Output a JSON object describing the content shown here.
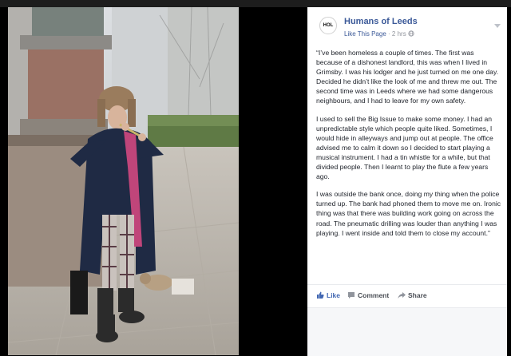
{
  "post": {
    "page_name": "Humans of Leeds",
    "logo_text": "HOL",
    "like_page": "Like This Page",
    "separator": "·",
    "time": "2 hrs",
    "paragraphs": [
      "“I’ve been homeless a couple of times. The first was because of a dishonest landlord, this was when I lived in Grimsby. I was his lodger and he just turned on me one day. Decided he didn’t like the look of me and threw me out. The second time was in Leeds where we had some dangerous neighbours, and I had to leave for my own safety.",
      "I used to sell the Big Issue to make some money. I had an unpredictable style which people quite liked. Sometimes, I would hide in alleyways and jump out at people. The office advised me to calm it down so I decided to start playing a musical instrument. I had a tin whistle for a while, but that divided people. Then I learnt to play the flute a few years ago.",
      "I was outside the bank once, doing my thing when the police turned up. The bank had phoned them to move me on. Ironic thing was that there was building work going on across the road. The pneumatic drilling was louder than anything I was playing. I went inside and told them to close my account.”"
    ],
    "actions": {
      "like": "Like",
      "comment": "Comment",
      "share": "Share"
    }
  },
  "photo": {
    "subject": "busker-playing-flute"
  },
  "colors": {
    "brand": "#3b5998",
    "link": "#4267b2",
    "meta": "#90949c",
    "text": "#1d2129"
  }
}
